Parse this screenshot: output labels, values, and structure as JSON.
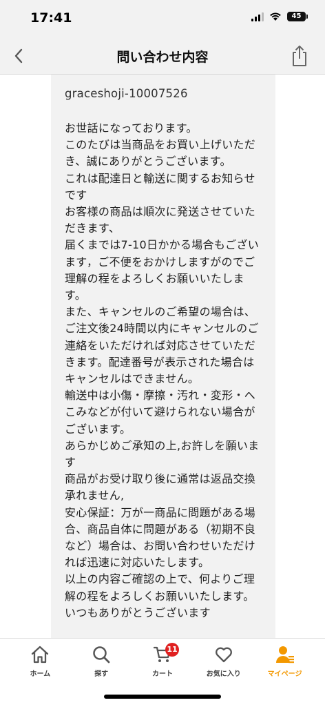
{
  "status_bar": {
    "time": "17:41",
    "battery": "45"
  },
  "nav": {
    "title": "問い合わせ内容",
    "back_icon": "chevron-left-icon",
    "share_icon": "share-icon"
  },
  "message": {
    "id": "graceshoji-10007526",
    "body": "お世話になっております。\nこのたびは当商品をお買い上げいただき、誠にありがとうございます。\nこれは配達日と輸送に関するお知らせです\nお客様の商品は順次に発送させていただきます、\n届くまでは7-10日かかる場合もございます，ご不便をおかけしますがのでご理解の程をよろしくお願いいたします。\nまた、キャンセルのご希望の場合は、ご注文後24時間以内にキャンセルのご連絡をいただければ対応させていただきます。配達番号が表示された場合はキャンセルはできません。\n輸送中は小傷・摩擦・汚れ・変形・へこみなどが付いて避けられない場合がございます。\nあらかじめご承知の上,お許しを願います\n商品がお受け取り後に通常は返品交換承れません,\n安心保証：万が一商品に問題がある場合、商品自体に問題がある（初期不良など）場合は、お問い合わせいただければ迅速に対応いたします。\n以上の内容ご確認の上で、何よりご理解の程をよろしくお願いいたします。\nいつもありがとうございます"
  },
  "tab_bar": {
    "accent_color": "#f39800",
    "tabs": [
      {
        "label": "ホーム",
        "icon": "home-icon"
      },
      {
        "label": "探す",
        "icon": "search-icon"
      },
      {
        "label": "カート",
        "icon": "cart-icon",
        "badge": "11"
      },
      {
        "label": "お気に入り",
        "icon": "heart-icon"
      },
      {
        "label": "マイページ",
        "icon": "user-icon",
        "active": true
      }
    ]
  }
}
